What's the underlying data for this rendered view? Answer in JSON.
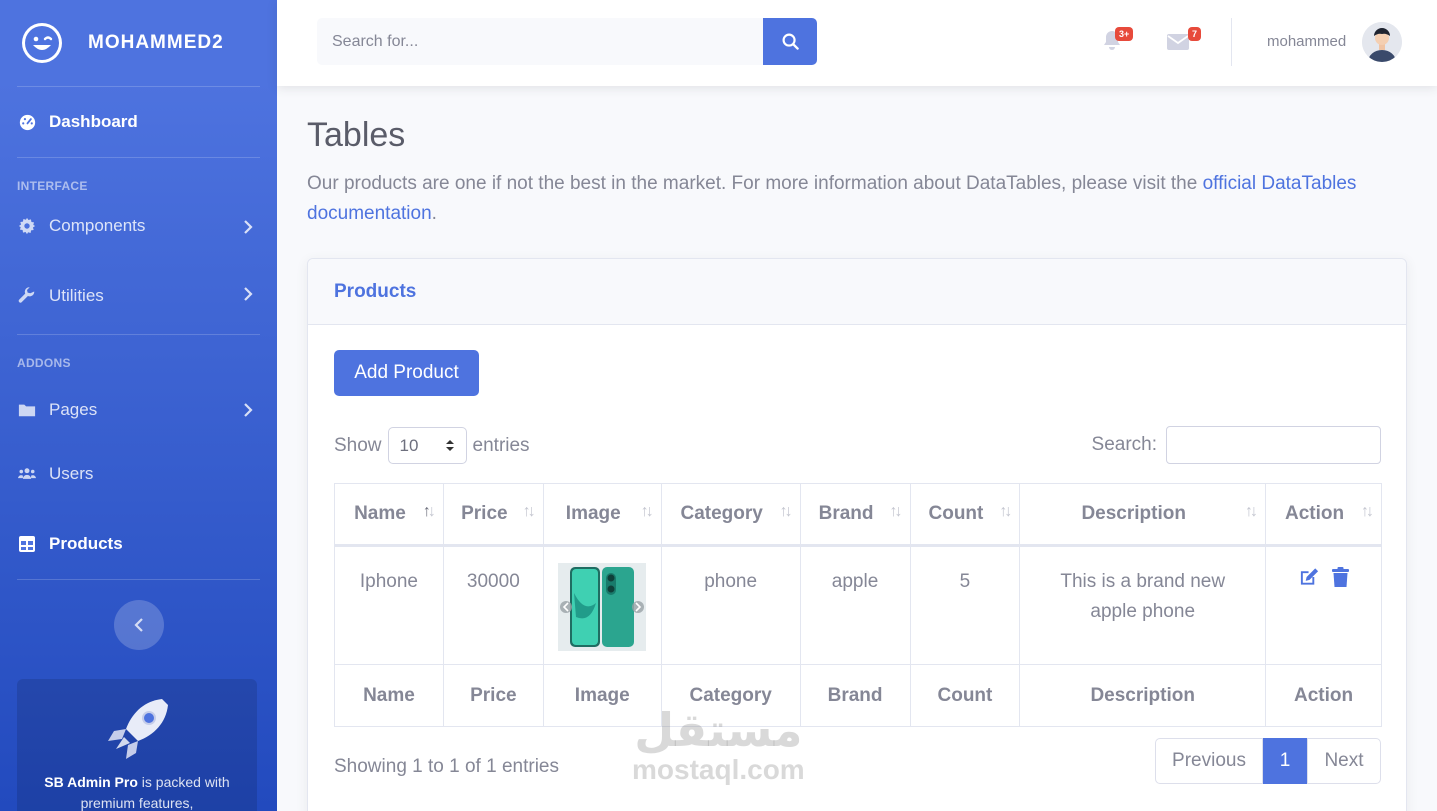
{
  "sidebar": {
    "brand": "MOHAMMED2",
    "items": {
      "dashboard": "Dashboard",
      "components": "Components",
      "utilities": "Utilities",
      "pages": "Pages",
      "users": "Users",
      "products": "Products"
    },
    "headings": {
      "interface": "INTERFACE",
      "addons": "ADDONS"
    },
    "promo": {
      "strong": "SB Admin Pro",
      "rest": " is packed with premium features,"
    }
  },
  "topbar": {
    "search_placeholder": "Search for...",
    "alerts_badge": "3+",
    "messages_badge": "7",
    "username": "mohammed"
  },
  "page": {
    "title": "Tables",
    "description": "Our products are one if not the best in the market. For more information about DataTables, please visit the ",
    "link_text": "official DataTables documentation",
    "description_end": "."
  },
  "card": {
    "header": "Products",
    "add_button": "Add Product",
    "show_label": "Show",
    "entries_value": "10",
    "entries_label": "entries",
    "search_label": "Search:",
    "columns": [
      "Name",
      "Price",
      "Image",
      "Category",
      "Brand",
      "Count",
      "Description",
      "Action"
    ],
    "rows": [
      {
        "name": "Iphone",
        "price": "30000",
        "category": "phone",
        "brand": "apple",
        "count": "5",
        "description": "This is a brand new apple phone"
      }
    ],
    "info": "Showing 1 to 1 of 1 entries",
    "pagination": {
      "previous": "Previous",
      "current": "1",
      "next": "Next"
    }
  },
  "watermark": {
    "arabic": "مستقل",
    "latin": "mostaql.com"
  },
  "colors": {
    "primary": "#4e73df",
    "danger": "#e74a3b",
    "text": "#858796"
  }
}
